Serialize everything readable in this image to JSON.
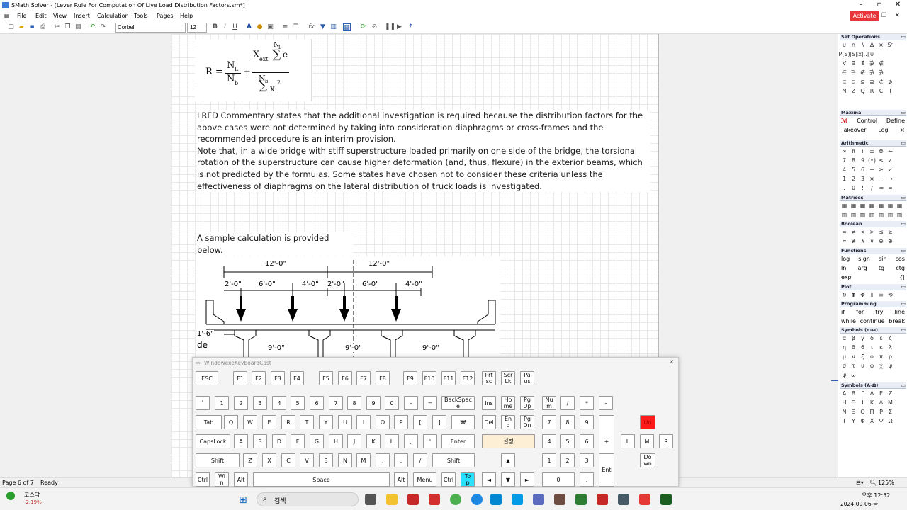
{
  "window": {
    "title": "SMath Solver - [Lever Rule For Computation Of Live Load Distribution Factors.sm*]",
    "activate": "Activate"
  },
  "menu": [
    "File",
    "Edit",
    "View",
    "Insert",
    "Calculation",
    "Tools",
    "Pages",
    "Help"
  ],
  "toolbar": {
    "font": "Corbel",
    "size": "12"
  },
  "formula": {
    "R": "R =",
    "NL": "N",
    "NLsub": "L",
    "Nb": "N",
    "Nbsub": "b",
    "plus": "+",
    "Xext": "X",
    "Xextsub": "ext",
    "sumTop": "N",
    "sumTopSub": "L",
    "e": "e",
    "Nb2": "N",
    "Nb2sub": "b",
    "x2": "x",
    "x2sup": "2"
  },
  "document": {
    "para1": "LRFD Commentary states that the additional investigation is required because the distribution factors for the above cases were not determined by taking into consideration diaphragms or cross-frames and the recommended procedure is an interim provision.",
    "para2": "Note that, in a wide bridge with stiff superstructure loaded primarily on one side of the bridge, the torsional rotation of the superstructure can cause higher deformation (and, thus, flexure) in the exterior beams, which is not predicted by the formulas. Some states have chosen not to consider these criteria unless the effectiveness of diaphragms on the lateral distribution of truck loads is investigated.",
    "para3": "A sample calculation is provided below.",
    "fig": {
      "d1": "12'-0\"",
      "d2": "12'-0\"",
      "d3": "2'-0\"",
      "d4": "6'-0\"",
      "d5": "4'-0\"",
      "d6": "2'-0\"",
      "d7": "6'-0\"",
      "d8": "4'-0\"",
      "d9": "1'-6\"",
      "d10": "de",
      "d11": "9'-0\"",
      "d12": "9'-0\"",
      "d13": "9'-0\""
    }
  },
  "panel": {
    "setops": {
      "title": "Set Operations",
      "rows": [
        [
          "∪",
          "∩",
          "∖",
          "Δ",
          "×",
          "Sᶜ"
        ],
        [
          "P(S)",
          "|S|",
          "|x|..|",
          "∪"
        ],
        [
          "∀",
          "∃",
          "∄",
          "∌",
          "∉"
        ],
        [
          "∈",
          "∋",
          "∉",
          "∌",
          "∌"
        ],
        [
          "⊂",
          "⊃",
          "⊆",
          "⊇",
          "⊄",
          "⊅"
        ],
        [
          "N",
          "Z",
          "Q",
          "R",
          "C",
          "I"
        ]
      ]
    },
    "maxima": {
      "title": "Maxima",
      "row1": [
        "Control",
        "Define"
      ],
      "row2": [
        "Takeover",
        "Log",
        "×"
      ]
    },
    "arith": {
      "title": "Arithmetic",
      "rows": [
        [
          "∞",
          "π",
          "i",
          "±",
          "⊗",
          "←"
        ],
        [
          "7",
          "8",
          "9",
          "(•)",
          "≤",
          "✓"
        ],
        [
          "4",
          "5",
          "6",
          "−",
          "≥",
          "✓"
        ],
        [
          "1",
          "2",
          "3",
          "×",
          ",",
          "→"
        ],
        [
          ".",
          "0",
          "!",
          "/",
          "≔",
          "="
        ]
      ]
    },
    "matrices": {
      "title": "Matrices"
    },
    "boolean": {
      "title": "Boolean",
      "rows": [
        [
          "=",
          "≠",
          "<",
          ">",
          "≤",
          "≥"
        ],
        [
          "≈",
          "≢",
          "∧",
          "∨",
          "⊕",
          "⊕"
        ]
      ]
    },
    "functions": {
      "title": "Functions",
      "rows": [
        [
          "log",
          "sign",
          "sin",
          "cos"
        ],
        [
          "ln",
          "arg",
          "tg",
          "ctg"
        ],
        [
          "exp",
          "{|"
        ]
      ]
    },
    "plot": {
      "title": "Plot"
    },
    "prog": {
      "title": "Programming",
      "rows": [
        [
          "if",
          "for",
          "try",
          "line"
        ],
        [
          "while",
          "continue",
          "break"
        ]
      ]
    },
    "syma": {
      "title": "Symbols (α-ω)",
      "rows": [
        [
          "α",
          "β",
          "γ",
          "δ",
          "ε",
          "ζ"
        ],
        [
          "η",
          "θ",
          "ϑ",
          "ι",
          "κ",
          "λ"
        ],
        [
          "μ",
          "ν",
          "ξ",
          "ο",
          "π",
          "ρ"
        ],
        [
          "σ",
          "τ",
          "υ",
          "φ",
          "χ",
          "ψ"
        ],
        [
          "ψ",
          "ω"
        ]
      ]
    },
    "symA": {
      "title": "Symbols (Α-Ω)",
      "rows": [
        [
          "Α",
          "Β",
          "Γ",
          "Δ",
          "Ε",
          "Ζ"
        ],
        [
          "Η",
          "Θ",
          "Ι",
          "Κ",
          "Λ",
          "Μ"
        ],
        [
          "Ν",
          "Ξ",
          "Ο",
          "Π",
          "Ρ",
          "Σ"
        ],
        [
          "Τ",
          "Υ",
          "Φ",
          "Χ",
          "Ψ",
          "Ω"
        ]
      ]
    }
  },
  "status": {
    "page": "Page 6 of 7",
    "ready": "Ready",
    "zoom": "125%"
  },
  "keyboard": {
    "title": "WindowexeKeyboardCast"
  },
  "taskbar": {
    "stock_name": "코스닥",
    "stock_change": "-2.19%",
    "search": "검색",
    "time": "오후 12:52",
    "date": "2024-09-06-금"
  }
}
